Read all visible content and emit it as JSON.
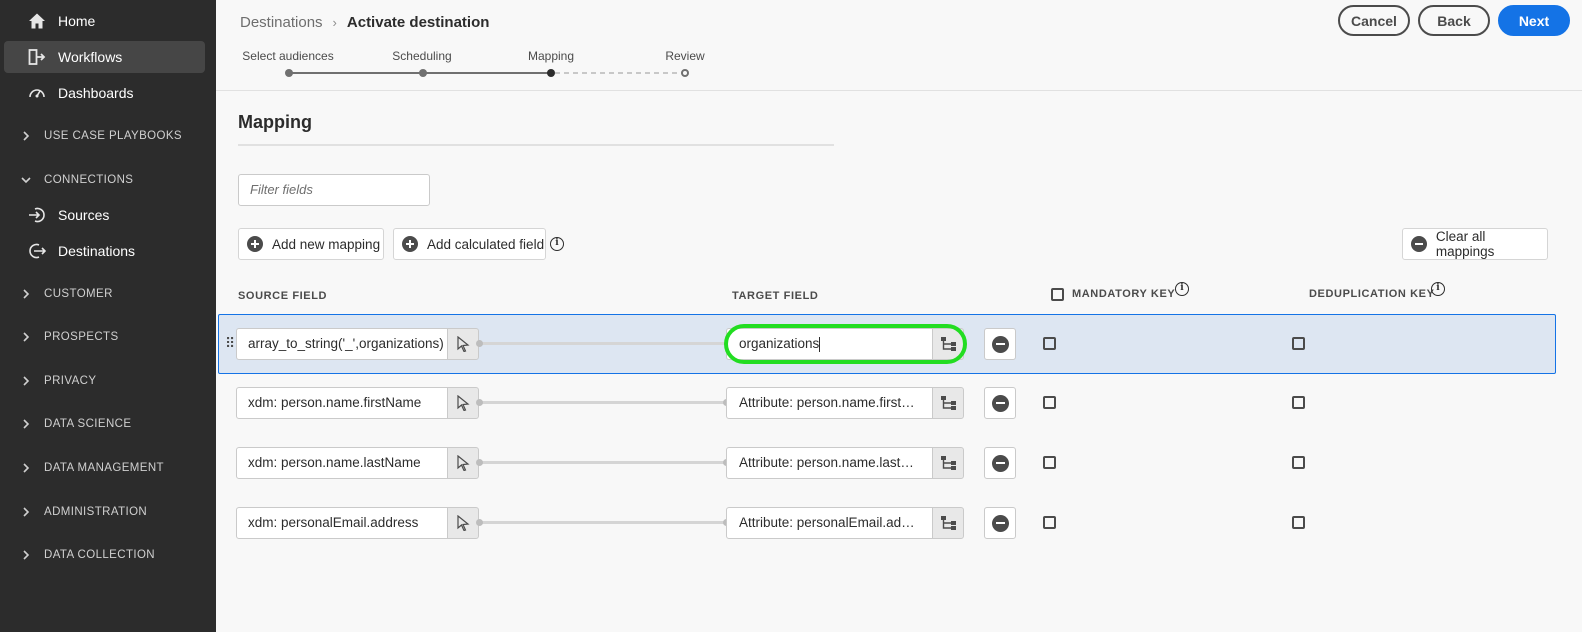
{
  "sidebar": {
    "items": [
      {
        "label": "Home",
        "icon": "home-icon"
      },
      {
        "label": "Workflows",
        "icon": "workflow-icon",
        "active": true
      },
      {
        "label": "Dashboards",
        "icon": "dashboard-icon"
      }
    ],
    "sections": [
      {
        "label": "USE CASE PLAYBOOKS",
        "expanded": false
      },
      {
        "label": "CONNECTIONS",
        "expanded": true
      },
      {
        "label": "CUSTOMER",
        "expanded": false
      },
      {
        "label": "PROSPECTS",
        "expanded": false
      },
      {
        "label": "PRIVACY",
        "expanded": false
      },
      {
        "label": "DATA SCIENCE",
        "expanded": false
      },
      {
        "label": "DATA MANAGEMENT",
        "expanded": false
      },
      {
        "label": "ADMINISTRATION",
        "expanded": false
      },
      {
        "label": "DATA COLLECTION",
        "expanded": false
      }
    ],
    "connections_items": [
      {
        "label": "Sources",
        "icon": "sources-icon"
      },
      {
        "label": "Destinations",
        "icon": "destinations-icon"
      }
    ]
  },
  "header": {
    "breadcrumb_parent": "Destinations",
    "breadcrumb_current": "Activate destination",
    "cancel_label": "Cancel",
    "back_label": "Back",
    "next_label": "Next",
    "steps": [
      {
        "label": "Select audiences",
        "state": "complete"
      },
      {
        "label": "Scheduling",
        "state": "complete"
      },
      {
        "label": "Mapping",
        "state": "current"
      },
      {
        "label": "Review",
        "state": "pending"
      }
    ]
  },
  "main": {
    "title": "Mapping",
    "filter_placeholder": "Filter fields",
    "add_mapping_label": "Add new mapping",
    "add_calculated_label": "Add calculated field",
    "clear_all_label": "Clear all mappings",
    "columns": {
      "source": "SOURCE FIELD",
      "target": "TARGET FIELD",
      "mandatory": "MANDATORY KEY",
      "dedup": "DEDUPLICATION KEY"
    },
    "rows": [
      {
        "source": "array_to_string('_',organizations)",
        "target": "organizations",
        "selected": true
      },
      {
        "source": "xdm: person.name.firstName",
        "target": "Attribute: person.name.firstName",
        "selected": false
      },
      {
        "source": "xdm: person.name.lastName",
        "target": "Attribute: person.name.lastName",
        "selected": false
      },
      {
        "source": "xdm: personalEmail.address",
        "target": "Attribute: personalEmail.address",
        "selected": false
      }
    ]
  },
  "colors": {
    "primary": "#1473e6",
    "sidebar_bg": "#2c2c2c",
    "highlight": "#22dd22",
    "selected_row": "#dde6f2"
  }
}
